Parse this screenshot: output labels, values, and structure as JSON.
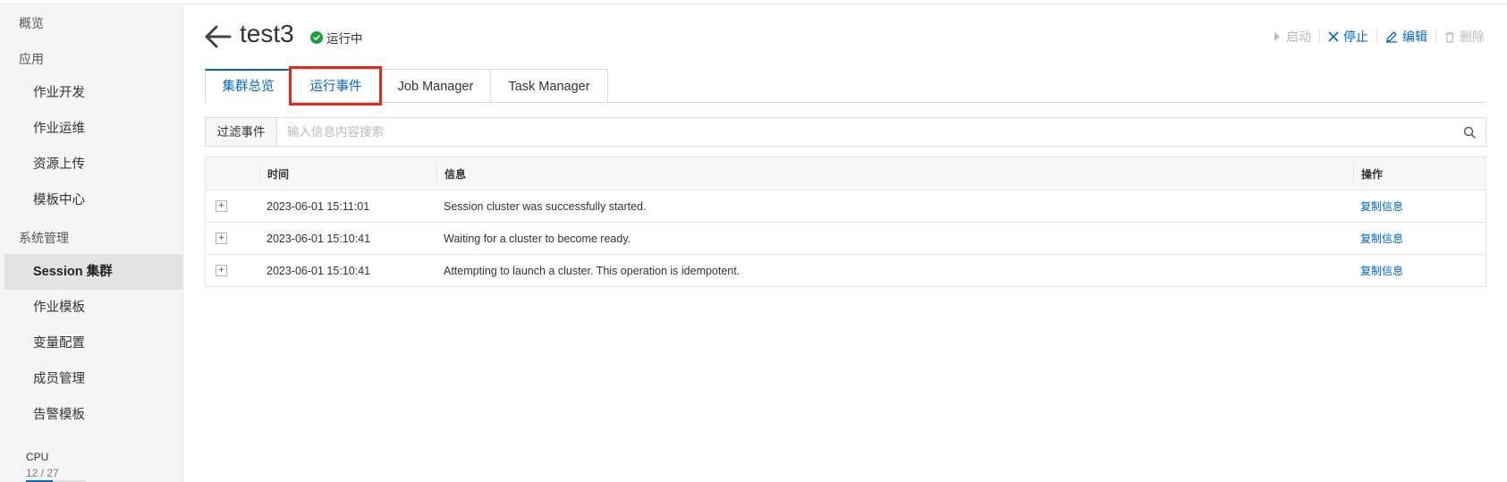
{
  "sidebar": {
    "groups": [
      {
        "label": "概览"
      },
      {
        "label": "应用"
      },
      {
        "label": "系统管理"
      }
    ],
    "items": [
      {
        "label": "作业开发"
      },
      {
        "label": "作业运维"
      },
      {
        "label": "资源上传"
      },
      {
        "label": "模板中心"
      },
      {
        "label": "Session 集群"
      },
      {
        "label": "作业模板"
      },
      {
        "label": "变量配置"
      },
      {
        "label": "成员管理"
      },
      {
        "label": "告警模板"
      }
    ],
    "active_item": "Session 集群",
    "cpu": {
      "label": "CPU",
      "value": "12 / 27",
      "used": 12,
      "total": 27
    }
  },
  "header": {
    "title": "test3",
    "status": "运行中",
    "status_color": "#1e9e3a",
    "actions": {
      "start": "启动",
      "stop": "停止",
      "edit": "编辑",
      "delete": "删除"
    }
  },
  "tabs": [
    {
      "label": "集群总览"
    },
    {
      "label": "运行事件"
    },
    {
      "label": "Job Manager"
    },
    {
      "label": "Task Manager"
    }
  ],
  "filter": {
    "label": "过滤事件",
    "placeholder": "输入信息内容搜索"
  },
  "table": {
    "columns": {
      "time": "时间",
      "message": "信息",
      "action": "操作"
    },
    "rows": [
      {
        "time": "2023-06-01 15:11:01",
        "message": "Session cluster was successfully started.",
        "action": "复制信息"
      },
      {
        "time": "2023-06-01 15:10:41",
        "message": "Waiting for a cluster to become ready.",
        "action": "复制信息"
      },
      {
        "time": "2023-06-01 15:10:41",
        "message": "Attempting to launch a cluster. This operation is idempotent.",
        "action": "复制信息"
      }
    ]
  },
  "colors": {
    "accent": "#0064c8",
    "highlight": "#e5281c"
  }
}
